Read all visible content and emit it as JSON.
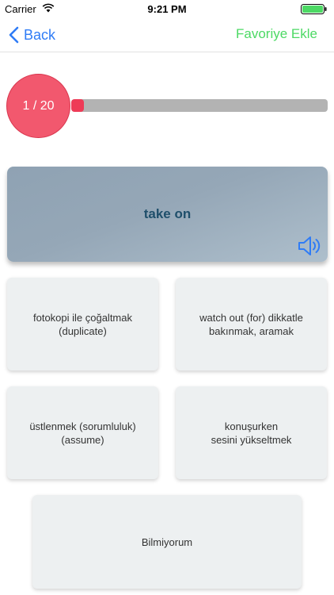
{
  "status_bar": {
    "carrier": "Carrier",
    "time": "9:21 PM"
  },
  "nav": {
    "back_label": "Back",
    "favorite_label": "Favoriye Ekle"
  },
  "progress": {
    "counter": "1 / 20",
    "current": 1,
    "total": 20,
    "fraction": 0.05
  },
  "card": {
    "word": "take on"
  },
  "options": [
    "fotokopi ile çoğaltmak\n(duplicate)",
    "watch out (for) dikkatle\nbakınmak, aramak",
    "üstlenmek (sorumluluk)\n(assume)",
    "konuşurken\nsesini yükseltmek"
  ],
  "unknown_label": "Bilmiyorum",
  "colors": {
    "accent_blue": "#2f7cf6",
    "accent_green": "#4cd964",
    "progress_red": "#ee3b57",
    "counter_pink": "#f2586e"
  }
}
